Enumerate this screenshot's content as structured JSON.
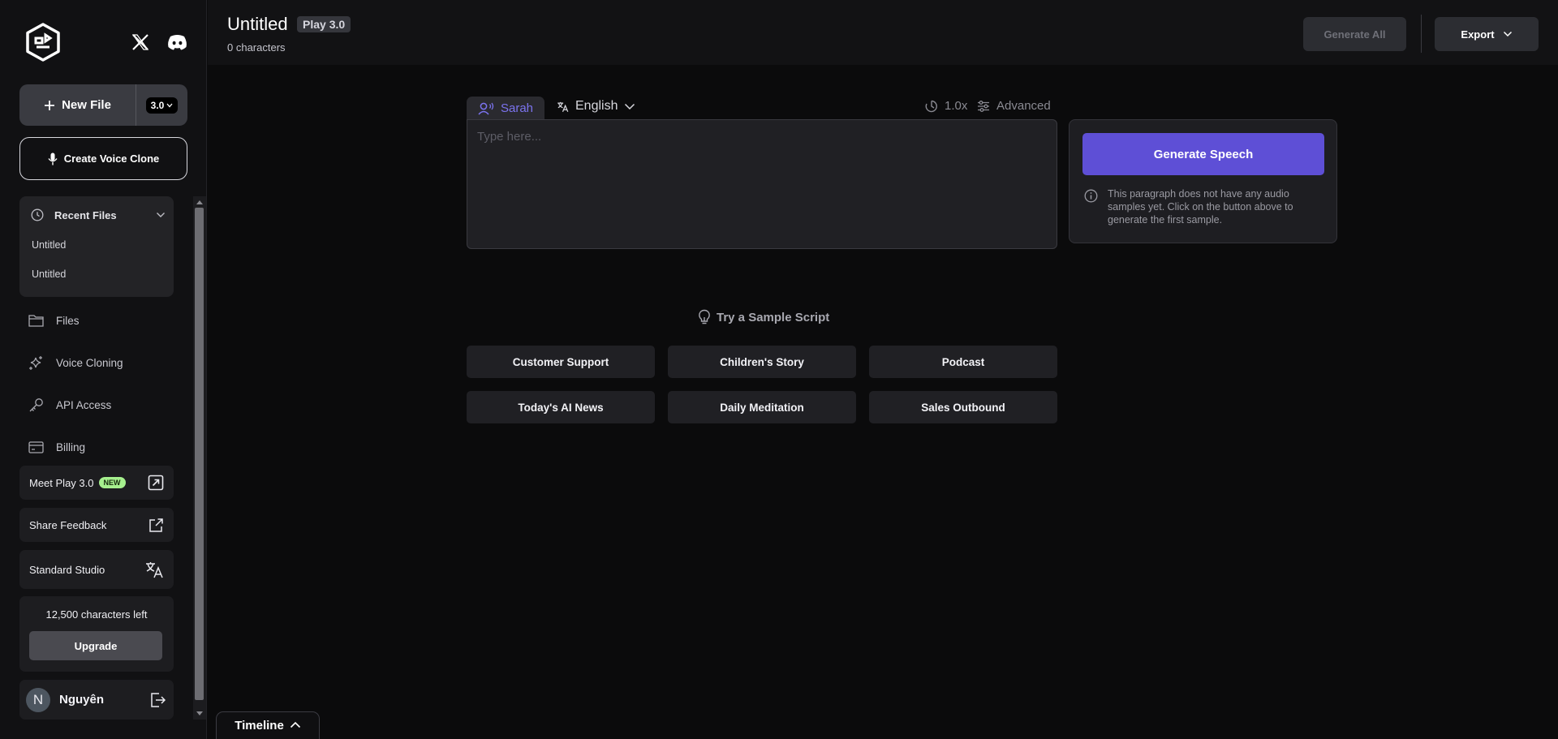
{
  "sidebar": {
    "new_file_label": "New File",
    "version": "3.0",
    "create_clone_label": "Create Voice Clone",
    "recent": {
      "title": "Recent Files",
      "items": [
        "Untitled",
        "Untitled"
      ]
    },
    "nav": {
      "files": "Files",
      "voice_cloning": "Voice Cloning",
      "api_access": "API Access",
      "billing": "Billing"
    },
    "meet_play_label": "Meet Play 3.0",
    "new_badge": "NEW",
    "share_feedback_label": "Share Feedback",
    "standard_studio_label": "Standard Studio",
    "chars_left": "12,500 characters left",
    "upgrade_label": "Upgrade",
    "user": {
      "initial": "N",
      "name": "Nguyên"
    }
  },
  "header": {
    "title": "Untitled",
    "model_badge": "Play 3.0",
    "char_count": "0 characters",
    "generate_all_label": "Generate All",
    "export_label": "Export"
  },
  "editor": {
    "voice_name": "Sarah",
    "language": "English",
    "speed": "1.0x",
    "advanced_label": "Advanced",
    "placeholder": "Type here...",
    "generate_speech_label": "Generate Speech",
    "info_text": "This paragraph does not have any audio samples yet. Click on the button above to generate the first sample."
  },
  "samples": {
    "title": "Try a Sample Script",
    "scripts": [
      "Customer Support",
      "Children's Story",
      "Podcast",
      "Today's AI News",
      "Daily Meditation",
      "Sales Outbound"
    ]
  },
  "timeline_label": "Timeline",
  "colors": {
    "accent": "#5e4fd6",
    "accent_text": "#7b73ee",
    "new_badge": "#a6f08e"
  }
}
